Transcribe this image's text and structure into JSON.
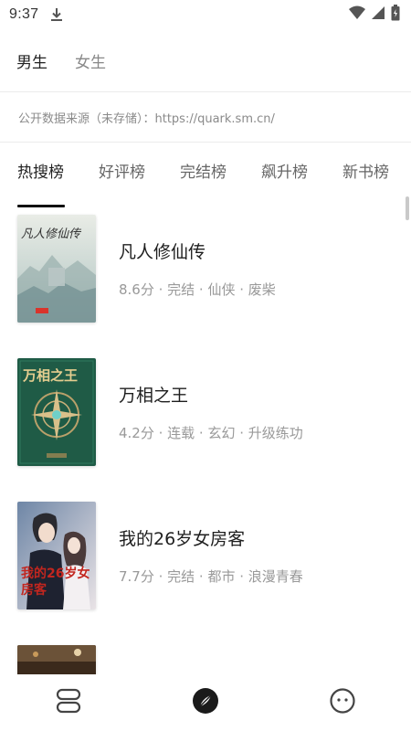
{
  "status": {
    "time": "9:37"
  },
  "gender_tabs": [
    {
      "label": "男生",
      "active": true
    },
    {
      "label": "女生",
      "active": false
    }
  ],
  "source_text": "公开数据来源（未存储）：https://quark.sm.cn/",
  "rank_tabs": [
    {
      "label": "热搜榜",
      "active": true
    },
    {
      "label": "好评榜",
      "active": false
    },
    {
      "label": "完结榜",
      "active": false
    },
    {
      "label": "飙升榜",
      "active": false
    },
    {
      "label": "新书榜",
      "active": false
    }
  ],
  "books": [
    {
      "title": "凡人修仙传",
      "meta": "8.6分 · 完结 · 仙侠 · 废柴",
      "cover_text": "凡人修仙传"
    },
    {
      "title": "万相之王",
      "meta": "4.2分 · 连载 · 玄幻 · 升级练功",
      "cover_text": "万相之王"
    },
    {
      "title": "我的26岁女房客",
      "meta": "7.7分 · 完结 · 都市 · 浪漫青春",
      "cover_text": "我的26岁女房客"
    },
    {
      "title": "",
      "meta": ""
    }
  ],
  "bottom_nav": [
    {
      "icon": "bookshelf-icon",
      "active": false
    },
    {
      "icon": "compass-icon",
      "active": true
    },
    {
      "icon": "face-icon",
      "active": false
    }
  ],
  "colors": {
    "text_primary": "#222222",
    "text_secondary": "#999999",
    "accent": "#111111"
  }
}
